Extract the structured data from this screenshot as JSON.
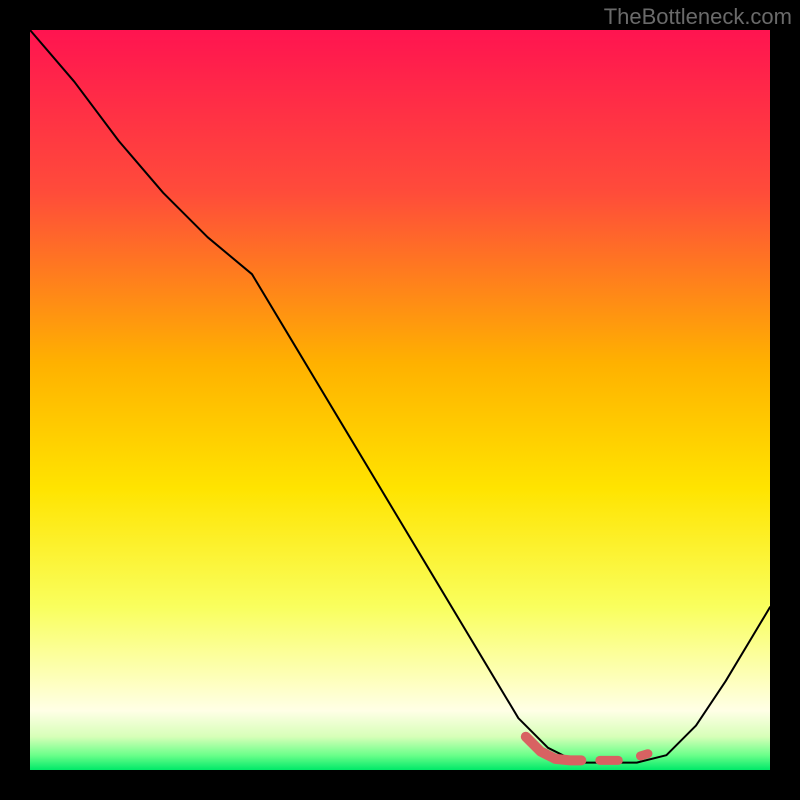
{
  "attribution": "TheBottleneck.com",
  "chart_data": {
    "type": "line",
    "title": "",
    "xlabel": "",
    "ylabel": "",
    "x_range": [
      0,
      100
    ],
    "y_range": [
      0,
      100
    ],
    "gradient_stops": [
      {
        "offset": 0,
        "color": "#ff1450"
      },
      {
        "offset": 22,
        "color": "#ff4c3a"
      },
      {
        "offset": 45,
        "color": "#ffb100"
      },
      {
        "offset": 62,
        "color": "#ffe400"
      },
      {
        "offset": 78,
        "color": "#f9ff5e"
      },
      {
        "offset": 87,
        "color": "#fdffb4"
      },
      {
        "offset": 92,
        "color": "#ffffe6"
      },
      {
        "offset": 95.5,
        "color": "#d7ffb8"
      },
      {
        "offset": 98,
        "color": "#6bff8a"
      },
      {
        "offset": 100,
        "color": "#00e969"
      }
    ],
    "series": [
      {
        "name": "curve",
        "x": [
          0,
          6,
          12,
          18,
          24,
          30,
          36,
          42,
          48,
          54,
          60,
          66,
          70,
          74,
          78,
          82,
          86,
          90,
          94,
          100
        ],
        "y": [
          100,
          93,
          85,
          78,
          72,
          67,
          57,
          47,
          37,
          27,
          17,
          7,
          3,
          1,
          1,
          1,
          2,
          6,
          12,
          22
        ],
        "stroke": "#000000",
        "width": 2
      },
      {
        "name": "highlight-segment",
        "x": [
          67,
          69,
          71,
          73,
          74.5
        ],
        "y": [
          4.5,
          2.5,
          1.5,
          1.3,
          1.3
        ],
        "stroke": "#d86262",
        "width": 10
      },
      {
        "name": "highlight-dash-1",
        "x": [
          77,
          79.5
        ],
        "y": [
          1.3,
          1.3
        ],
        "stroke": "#d86262",
        "width": 9
      },
      {
        "name": "highlight-dot",
        "x": [
          82.5,
          83.5
        ],
        "y": [
          1.9,
          2.2
        ],
        "stroke": "#d86262",
        "width": 9
      }
    ]
  }
}
